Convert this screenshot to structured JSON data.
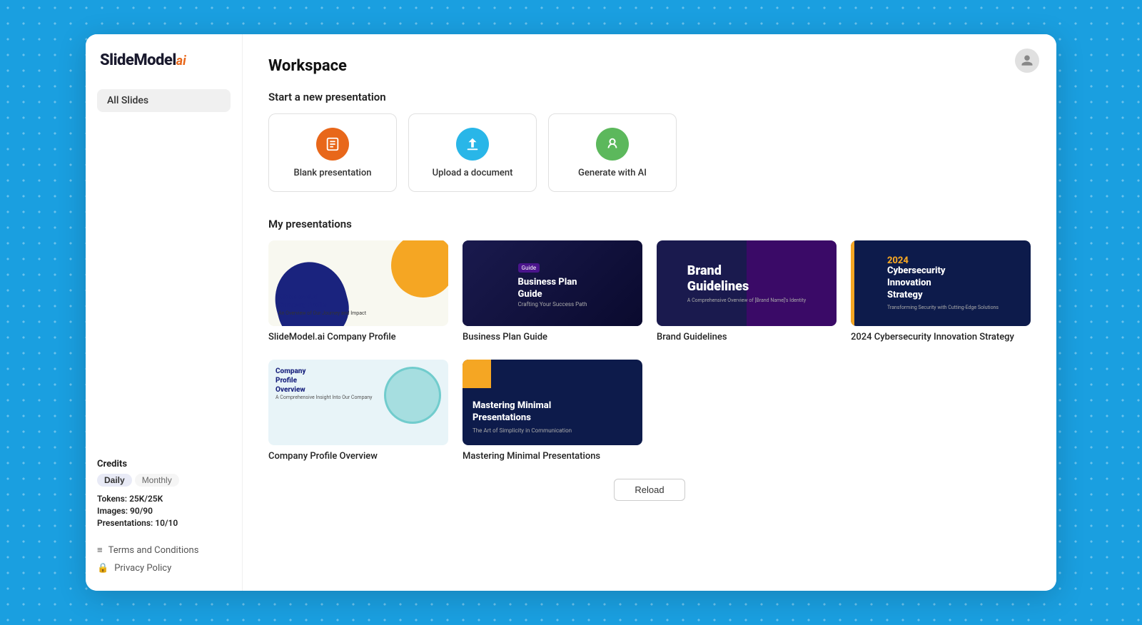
{
  "app": {
    "logo_main": "SlideModel",
    "logo_ai": "ai",
    "user_icon": "👤"
  },
  "sidebar": {
    "nav_items": [
      {
        "id": "all-slides",
        "label": "All Slides",
        "active": true
      }
    ],
    "credits": {
      "title": "Credits",
      "tabs": [
        {
          "label": "Daily",
          "active": true
        },
        {
          "label": "Monthly",
          "active": false
        }
      ],
      "stats": [
        {
          "key": "Tokens:",
          "value": "25K/25K"
        },
        {
          "key": "Images:",
          "value": "90/90"
        },
        {
          "key": "Presentations:",
          "value": "10/10"
        }
      ]
    },
    "footer_links": [
      {
        "id": "terms",
        "label": "Terms and Conditions",
        "icon": "≡"
      },
      {
        "id": "privacy",
        "label": "Privacy Policy",
        "icon": "🔒"
      }
    ]
  },
  "main": {
    "page_title": "Workspace",
    "section_new": "Start a new presentation",
    "section_my": "My presentations",
    "new_cards": [
      {
        "id": "blank",
        "label": "Blank presentation",
        "icon_class": "icon-blank",
        "icon_char": "📊"
      },
      {
        "id": "upload",
        "label": "Upload a document",
        "icon_class": "icon-upload",
        "icon_char": "⬆"
      },
      {
        "id": "ai",
        "label": "Generate with AI",
        "icon_class": "icon-ai",
        "icon_char": "🤖"
      }
    ],
    "presentations": [
      {
        "id": "company-profile",
        "title": "SlideModel.ai Company Profile",
        "thumb_class": "thumb-company-profile"
      },
      {
        "id": "business-plan",
        "title": "Business Plan Guide",
        "thumb_class": "thumb-business-plan"
      },
      {
        "id": "brand-guidelines",
        "title": "Brand Guidelines",
        "thumb_class": "thumb-brand"
      },
      {
        "id": "cybersecurity",
        "title": "2024 Cybersecurity Innovation Strategy",
        "thumb_class": "thumb-cyber"
      },
      {
        "id": "overview",
        "title": "Company Profile Overview",
        "thumb_class": "thumb-overview"
      },
      {
        "id": "minimal",
        "title": "Mastering Minimal Presentations",
        "thumb_class": "thumb-minimal"
      }
    ],
    "reload_label": "Reload"
  }
}
